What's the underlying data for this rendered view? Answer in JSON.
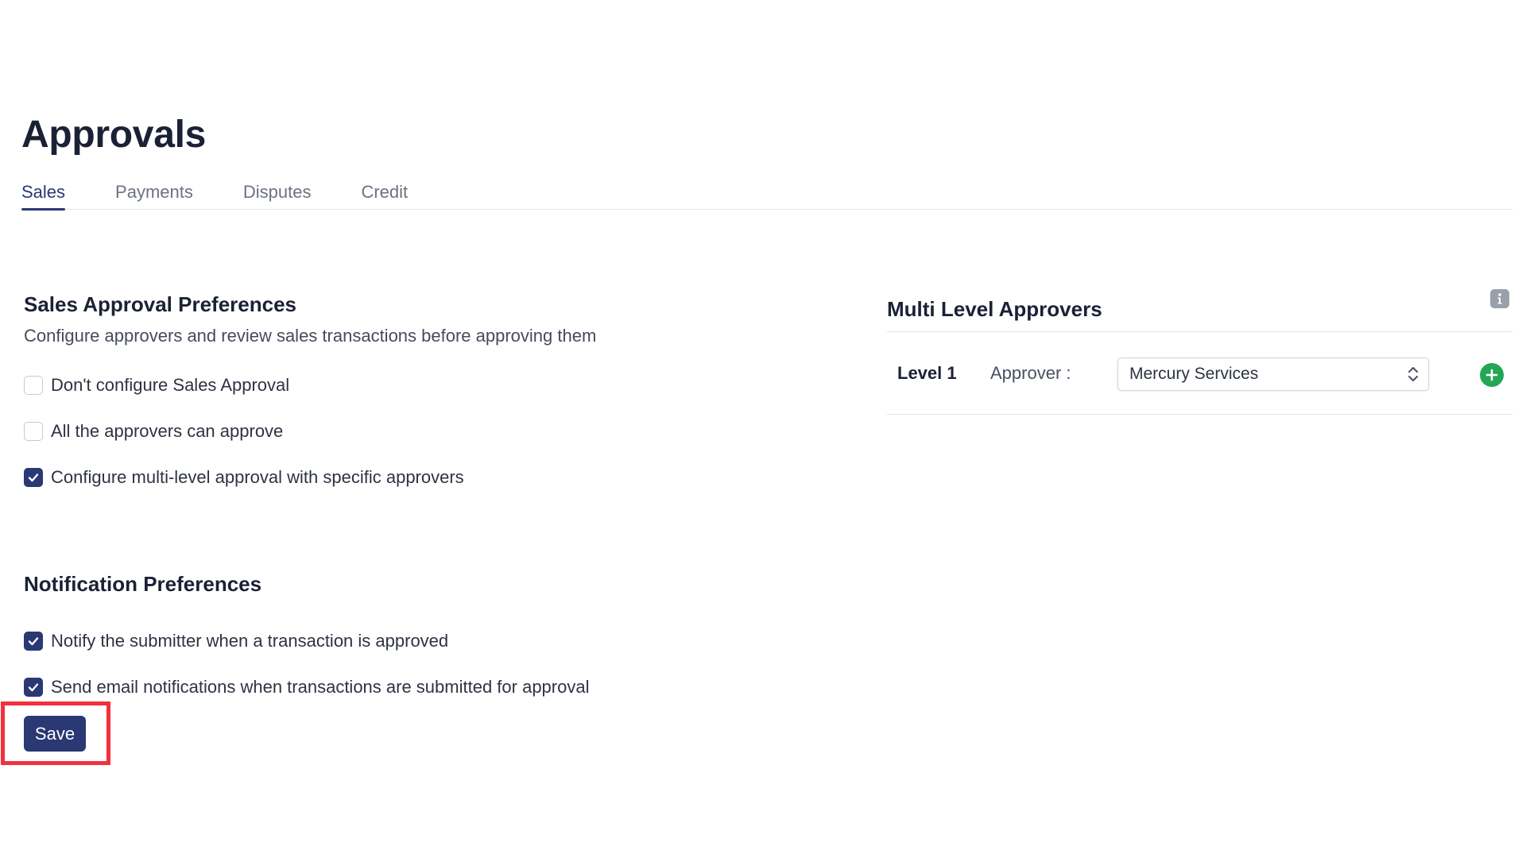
{
  "page": {
    "title": "Approvals"
  },
  "tabs": [
    {
      "label": "Sales",
      "active": true
    },
    {
      "label": "Payments",
      "active": false
    },
    {
      "label": "Disputes",
      "active": false
    },
    {
      "label": "Credit",
      "active": false
    }
  ],
  "sales_approval": {
    "title": "Sales Approval Preferences",
    "description": "Configure approvers and review sales transactions before approving them",
    "options": [
      {
        "label": "Don't configure Sales Approval",
        "checked": false
      },
      {
        "label": "All the approvers can approve",
        "checked": false
      },
      {
        "label": "Configure multi-level approval with specific approvers",
        "checked": true
      }
    ]
  },
  "notification": {
    "title": "Notification Preferences",
    "options": [
      {
        "label": "Notify the submitter when a transaction is approved",
        "checked": true
      },
      {
        "label": "Send email notifications when transactions are submitted for approval",
        "checked": true
      }
    ]
  },
  "actions": {
    "save_label": "Save"
  },
  "multi_level": {
    "title": "Multi Level Approvers",
    "info_icon": "info-icon",
    "levels": [
      {
        "level_label": "Level 1",
        "approver_label": "Approver :",
        "approver_value": "Mercury Services"
      }
    ]
  },
  "colors": {
    "primary": "#2a3873",
    "add_green": "#24a654",
    "highlight_red": "#f1313c"
  }
}
